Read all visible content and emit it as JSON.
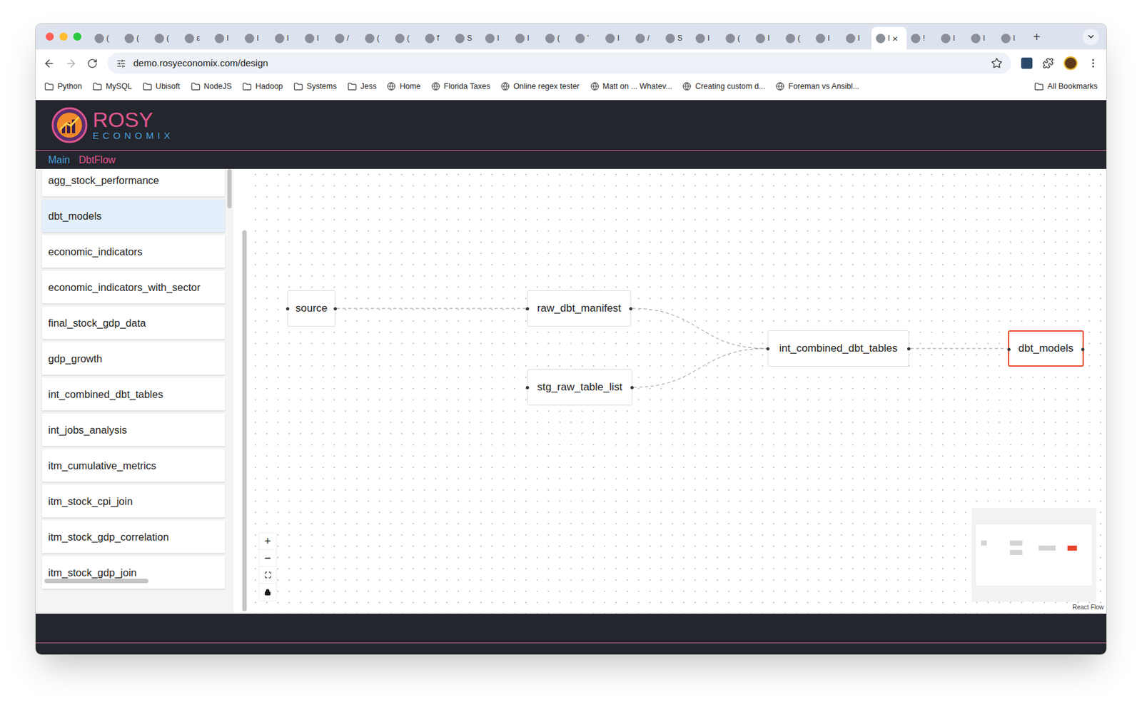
{
  "browser": {
    "tabs": [
      {
        "label": "(",
        "selected": false
      },
      {
        "label": "(",
        "selected": false
      },
      {
        "label": "(",
        "selected": false
      },
      {
        "label": "ε",
        "selected": false
      },
      {
        "label": "I",
        "selected": false
      },
      {
        "label": "I",
        "selected": false
      },
      {
        "label": "I",
        "selected": false
      },
      {
        "label": "I",
        "selected": false
      },
      {
        "label": "/",
        "selected": false
      },
      {
        "label": "(",
        "selected": false
      },
      {
        "label": "(",
        "selected": false
      },
      {
        "label": "f",
        "selected": false
      },
      {
        "label": "S",
        "selected": false
      },
      {
        "label": "I",
        "selected": false
      },
      {
        "label": "I",
        "selected": false
      },
      {
        "label": "(",
        "selected": false
      },
      {
        "label": "'",
        "selected": false
      },
      {
        "label": "I",
        "selected": false
      },
      {
        "label": "/",
        "selected": false
      },
      {
        "label": "S",
        "selected": false
      },
      {
        "label": "I",
        "selected": false
      },
      {
        "label": "(",
        "selected": false
      },
      {
        "label": "I",
        "selected": false
      },
      {
        "label": "(",
        "selected": false
      },
      {
        "label": "I",
        "selected": false
      },
      {
        "label": "I",
        "selected": false
      },
      {
        "label": "I",
        "selected": true
      },
      {
        "label": "!",
        "selected": false
      },
      {
        "label": "I",
        "selected": false
      },
      {
        "label": "I",
        "selected": false
      },
      {
        "label": "I",
        "selected": false
      }
    ],
    "close_tab": "×",
    "new_tab": "+",
    "url": "demo.rosyeconomix.com/design",
    "bookmarks": [
      {
        "label": "Python",
        "kind": "folder"
      },
      {
        "label": "MySQL",
        "kind": "folder"
      },
      {
        "label": "Ubisoft",
        "kind": "folder"
      },
      {
        "label": "NodeJS",
        "kind": "folder"
      },
      {
        "label": "Hadoop",
        "kind": "folder"
      },
      {
        "label": "Systems",
        "kind": "folder"
      },
      {
        "label": "Jess",
        "kind": "folder"
      },
      {
        "label": "Home",
        "kind": "link"
      },
      {
        "label": "Florida Taxes",
        "kind": "link"
      },
      {
        "label": "Online regex tester",
        "kind": "link"
      },
      {
        "label": "Matt on ... Whatev...",
        "kind": "link"
      },
      {
        "label": "Creating custom d...",
        "kind": "link"
      },
      {
        "label": "Foreman vs Ansibl...",
        "kind": "link"
      }
    ],
    "all_bookmarks": "All Bookmarks"
  },
  "header": {
    "logo_top": "ROSY",
    "logo_bottom": "ECONOMIX"
  },
  "nav": [
    {
      "label": "Main",
      "selected": false
    },
    {
      "label": "DbtFlow",
      "selected": true
    }
  ],
  "sidebar": {
    "items": [
      {
        "label": "agg_stock_performance",
        "selected": false
      },
      {
        "label": "dbt_models",
        "selected": true
      },
      {
        "label": "economic_indicators",
        "selected": false
      },
      {
        "label": "economic_indicators_with_sector",
        "selected": false
      },
      {
        "label": "final_stock_gdp_data",
        "selected": false
      },
      {
        "label": "gdp_growth",
        "selected": false
      },
      {
        "label": "int_combined_dbt_tables",
        "selected": false
      },
      {
        "label": "int_jobs_analysis",
        "selected": false
      },
      {
        "label": "itm_cumulative_metrics",
        "selected": false
      },
      {
        "label": "itm_stock_cpi_join",
        "selected": false
      },
      {
        "label": "itm_stock_gdp_correlation",
        "selected": false
      },
      {
        "label": "itm_stock_gdp_join",
        "selected": false
      }
    ]
  },
  "diagram": {
    "nodes": [
      {
        "label": "source",
        "selected": false
      },
      {
        "label": "raw_dbt_manifest",
        "selected": false
      },
      {
        "label": "stg_raw_table_list",
        "selected": false
      },
      {
        "label": "int_combined_dbt_tables",
        "selected": false
      },
      {
        "label": "dbt_models",
        "selected": true
      }
    ],
    "edges": [
      {
        "from": "source",
        "to": "raw_dbt_manifest"
      },
      {
        "from": "raw_dbt_manifest",
        "to": "int_combined_dbt_tables"
      },
      {
        "from": "stg_raw_table_list",
        "to": "int_combined_dbt_tables"
      },
      {
        "from": "int_combined_dbt_tables",
        "to": "dbt_models"
      }
    ],
    "controls": [
      "+",
      "−"
    ],
    "attribution": "React Flow"
  }
}
